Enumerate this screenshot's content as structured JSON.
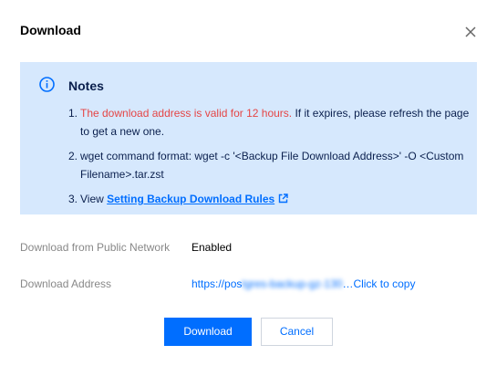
{
  "dialog": {
    "title": "Download",
    "close_icon": "close-icon"
  },
  "notes": {
    "icon": "info-icon",
    "title": "Notes",
    "items": [
      {
        "number": "1.",
        "highlight": "The download address is valid for 12 hours.",
        "text": " If it expires, please refresh the page to get a new one."
      },
      {
        "number": "2.",
        "text": "wget command format: wget -c '<Backup File Download Address>' -O <Custom Filename>.tar.zst"
      },
      {
        "number": "3.",
        "text": "View ",
        "link_label": "Setting Backup Download Rules",
        "link_icon": "external-link-icon"
      }
    ]
  },
  "fields": {
    "public_network": {
      "label": "Download from Public Network",
      "value": "Enabled"
    },
    "address": {
      "label": "Download Address",
      "prefix": "https://pos",
      "obscured": "tgres-backup-gz-130",
      "suffix": "…Click to copy"
    }
  },
  "buttons": {
    "download": "Download",
    "cancel": "Cancel"
  },
  "colors": {
    "accent": "#006eff",
    "notes_bg": "#d6e8fd",
    "warning_text": "#e54545",
    "label_text": "#888888"
  }
}
